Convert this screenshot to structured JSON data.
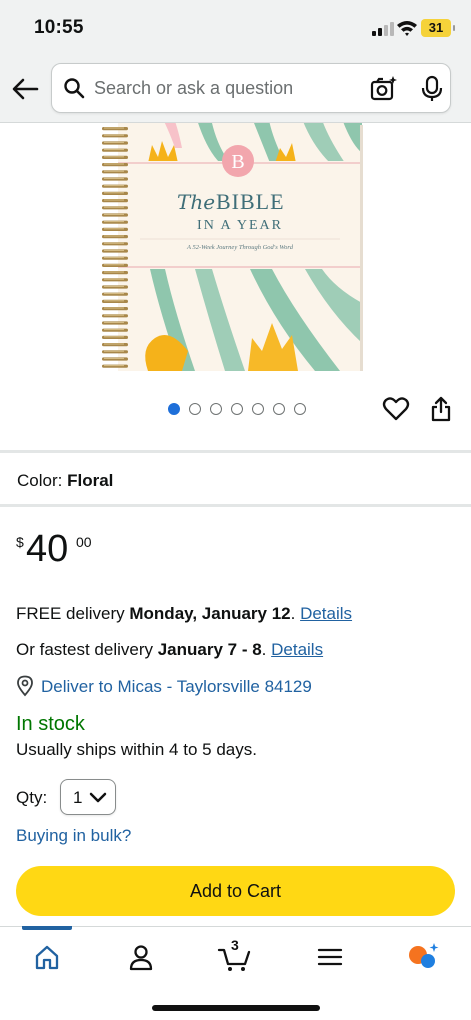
{
  "status_bar": {
    "time": "10:55",
    "battery": "31"
  },
  "search": {
    "placeholder": "Search or ask a question"
  },
  "product": {
    "cover": {
      "title_the": "The",
      "title_bible": "BIBLE",
      "title_year": "IN A YEAR",
      "subtitle": "A 52-Week Journey Through God's Word",
      "logo_letter": "B"
    },
    "image_count": 7,
    "active_image": 0
  },
  "color": {
    "label": "Color:",
    "value": "Floral"
  },
  "price": {
    "symbol": "$",
    "whole": "40",
    "fraction": "00"
  },
  "delivery": {
    "free_prefix": "FREE delivery ",
    "free_date": "Monday, January 12",
    "free_suffix": ". ",
    "details_1": "Details",
    "fast_prefix": "Or fastest delivery ",
    "fast_date": "January 7 - 8",
    "fast_suffix": ". ",
    "details_2": "Details",
    "deliver_to": "Deliver to Micas - Taylorsville 84129"
  },
  "stock": {
    "status": "In stock",
    "ships": "Usually ships within 4 to 5 days."
  },
  "qty": {
    "label": "Qty:",
    "value": "1"
  },
  "bulk_link": "Buying in bulk?",
  "add_to_cart": "Add to Cart",
  "nav": {
    "cart_count": "3"
  },
  "colors": {
    "accent": "#ffd814",
    "link": "#2162a1",
    "in_stock": "#007600",
    "active_dot": "#1e6fd9"
  }
}
